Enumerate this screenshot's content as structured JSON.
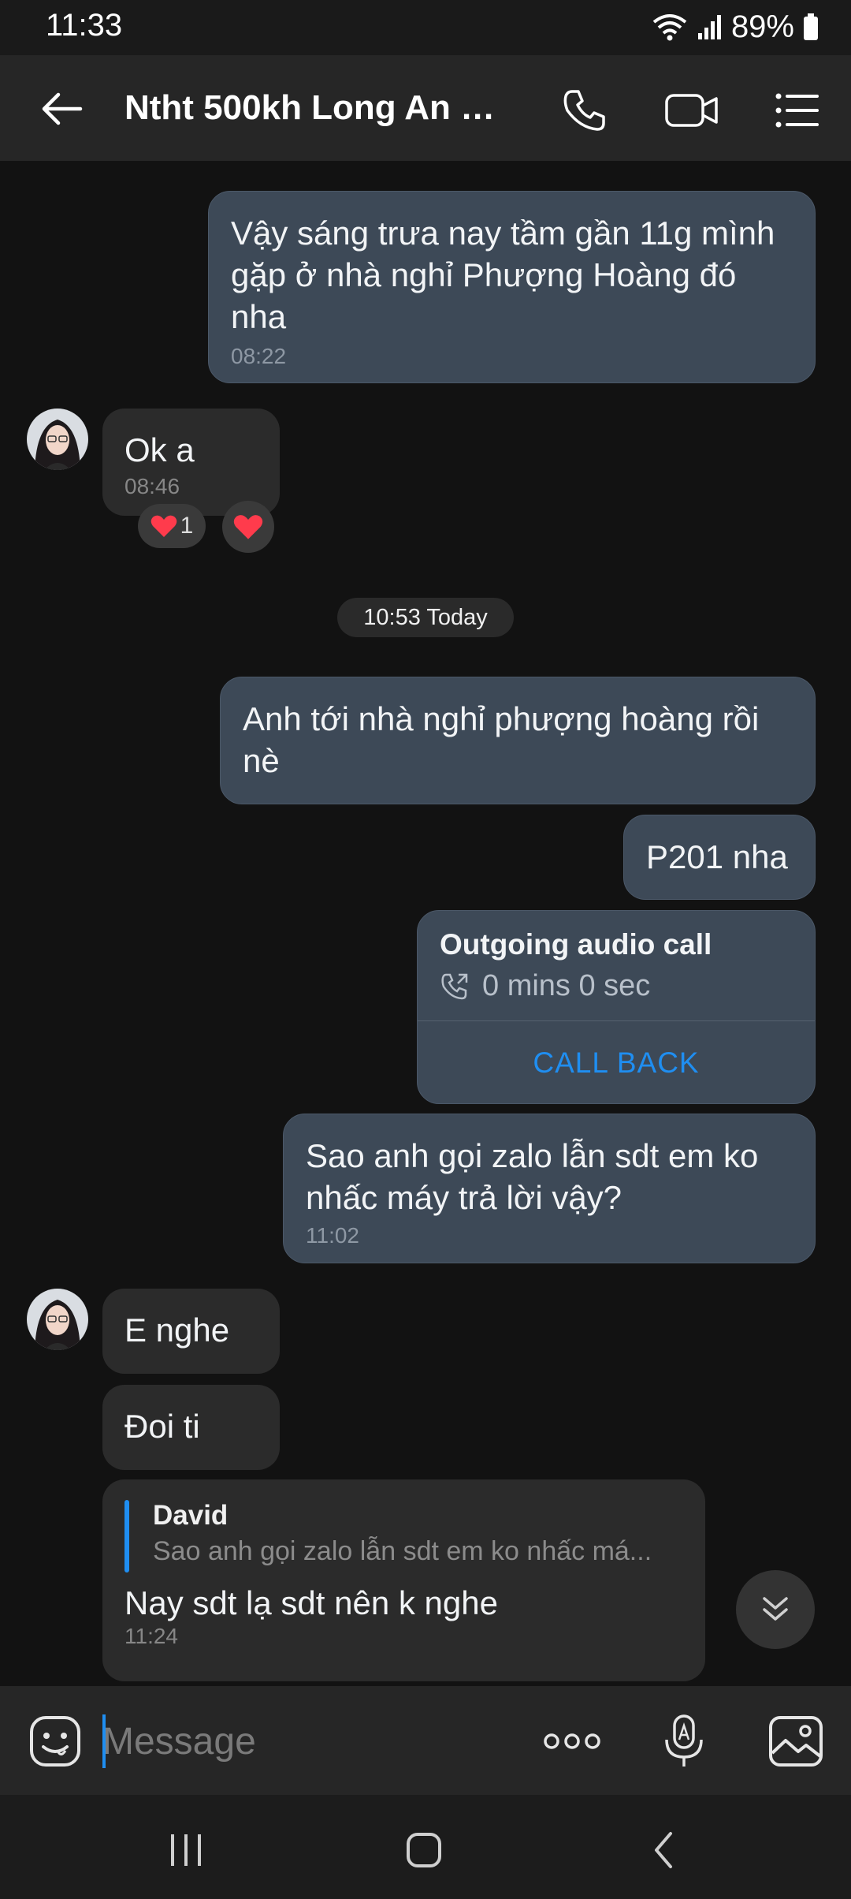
{
  "status_bar": {
    "time": "11:33",
    "battery": "89%"
  },
  "header": {
    "title": "Ntht 500kh Long An 0..."
  },
  "messages": {
    "m1": {
      "text": "Vậy sáng trưa nay tầm gần 11g mình gặp ở nhà nghỉ Phượng Hoàng đó nha",
      "time": "08:22"
    },
    "m2": {
      "text": "Ok a",
      "time": "08:46",
      "reaction_count": "1"
    },
    "date_separator": "10:53 Today",
    "m3": {
      "text": "Anh tới nhà nghỉ phượng hoàng rồi nè"
    },
    "m4": {
      "text": "P201 nha"
    },
    "call": {
      "title": "Outgoing audio call",
      "duration": "0 mins 0 sec",
      "action": "CALL BACK"
    },
    "m5": {
      "text": "Sao anh gọi zalo lẫn sdt em ko nhấc máy trả lời vậy?",
      "time": "11:02"
    },
    "m6": {
      "text": "E nghe"
    },
    "m7": {
      "text": "Đoi ti"
    },
    "m8": {
      "reply_name": "David",
      "reply_snippet": "Sao anh gọi zalo lẫn sdt em ko nhấc má...",
      "text": "Nay sdt lạ sdt nên k nghe",
      "time": "11:24"
    }
  },
  "composer": {
    "placeholder": "Message"
  },
  "icons": {
    "back": "arrow-left-icon",
    "call": "phone-icon",
    "video": "video-icon",
    "menu": "list-menu-icon",
    "emoji": "emoji-icon",
    "more": "more-dots-icon",
    "voice": "mic-icon",
    "gallery": "image-icon",
    "scroll": "chevron-double-down-icon"
  },
  "colors": {
    "accent": "#1f8ef1",
    "outgoing_bubble": "#3d4957",
    "incoming_bubble": "#2b2b2b",
    "background": "#121212"
  }
}
